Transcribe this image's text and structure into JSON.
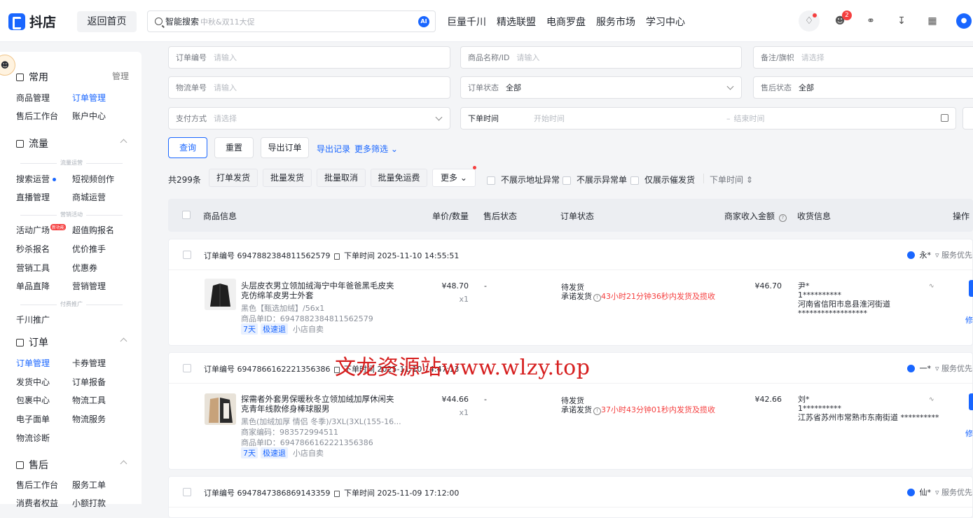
{
  "app": {
    "logo_text": "抖店",
    "home_button": "返回首页"
  },
  "search": {
    "label": "智能搜索",
    "placeholder": "中秋&双11大促",
    "ai_badge": "AI"
  },
  "topnav": [
    "巨量千川",
    "精选联盟",
    "电商罗盘",
    "服务市场",
    "学习中心"
  ],
  "top_icons": {
    "message_badge": "2"
  },
  "sidebar": {
    "common": {
      "title": "常用",
      "manage": "管理",
      "items": [
        "商品管理",
        "订单管理",
        "售后工作台",
        "账户中心"
      ]
    },
    "traffic": {
      "title": "流量",
      "sub1": "流量运营",
      "items1": [
        "搜索运营",
        "短视频创作",
        "直播管理",
        "商城运营"
      ],
      "sub2": "营销活动",
      "items2": [
        "活动广场",
        "超值购报名",
        "秒杀报名",
        "优价推手",
        "营销工具",
        "优惠券",
        "单品直降",
        "营销管理"
      ],
      "hot": "新功能",
      "sub3": "付费推广",
      "items3": [
        "千川推广"
      ]
    },
    "order": {
      "title": "订单",
      "items": [
        "订单管理",
        "卡券管理",
        "发货中心",
        "订单报备",
        "包裹中心",
        "物流工具",
        "电子面单",
        "物流服务",
        "物流诊断"
      ]
    },
    "aftersale": {
      "title": "售后",
      "items": [
        "售后工作台",
        "服务工单",
        "消费者权益",
        "小额打款"
      ]
    }
  },
  "filters": {
    "order_no": {
      "label": "订单编号",
      "placeholder": "请输入"
    },
    "product": {
      "label": "商品名称/ID",
      "placeholder": "请输入"
    },
    "remark": {
      "label": "备注/旗帜",
      "placeholder": "请选择"
    },
    "logistics": {
      "label": "物流单号",
      "placeholder": "请输入"
    },
    "order_status": {
      "label": "订单状态",
      "value": "全部"
    },
    "after_status": {
      "label": "售后状态",
      "value": "全部"
    },
    "payment": {
      "label": "支付方式",
      "placeholder": "请选择"
    },
    "time": {
      "label": "下单时间",
      "start": "开始时间",
      "sep": "–",
      "end": "结束时间"
    }
  },
  "actions": {
    "query": "查询",
    "reset": "重置",
    "export": "导出订单",
    "export_log": "导出记录",
    "more_filter": "更多筛选"
  },
  "bulk": {
    "count": "共299条",
    "buttons": [
      "打单发货",
      "批量发货",
      "批量取消",
      "批量免运费",
      "更多"
    ],
    "checks": [
      "不展示地址异常",
      "不展示异常单",
      "仅展示催发货"
    ],
    "sort": "下单时间"
  },
  "table_headers": [
    "商品信息",
    "单价/数量",
    "售后状态",
    "订单状态",
    "商家收入金额",
    "收货信息",
    "操作"
  ],
  "orders": [
    {
      "order_no_label": "订单编号",
      "order_no": "6947882384811562579",
      "time_label": "下单时间",
      "time": "2025-11-10 14:55:51",
      "buyer": "永*",
      "service": "服务优先",
      "title": "头层皮衣男立领加绒海宁中年爸爸黑毛皮夹克仿绵羊皮男士外套",
      "spec": "黑色【甄选加绒】/56x1",
      "merchant_code": "",
      "product_id": "商品单ID：6947882384811562579",
      "tags": [
        "7天",
        "极速退",
        "小店自卖"
      ],
      "price": "¥48.70",
      "qty": "x1",
      "after": "-",
      "status": "待发货",
      "promise_prefix": "承诺发货",
      "promise_red": "43小时21分钟36秒内发货及揽收",
      "income": "¥46.70",
      "recv_name": "尹*",
      "recv_phone": "1**********",
      "recv_addr": "河南省信阳市息县淮河街道 ******************",
      "op": "修"
    },
    {
      "order_no_label": "订单编号",
      "order_no": "6947866162221356386",
      "time_label": "下单时间",
      "time": "2025-11-10 14:47:13",
      "buyer": "一*",
      "service": "服务优先",
      "title": "探需者外套男保暖秋冬立领加绒加厚休闲夹克青年线款修身棒球服男",
      "spec": "黑色(加绒加厚 情侣 冬季)/3XL(3XL(155-16...",
      "merchant_code": "商家编码：983572994511",
      "product_id": "商品单ID：6947866162221356386",
      "tags": [
        "7天",
        "极速退",
        "小店自卖"
      ],
      "price": "¥44.66",
      "qty": "x1",
      "after": "-",
      "status": "待发货",
      "promise_prefix": "承诺发货",
      "promise_red": "37小时43分钟01秒内发货及揽收",
      "income": "¥42.66",
      "recv_name": "刘*",
      "recv_phone": "1**********",
      "recv_addr": "江苏省苏州市常熟市东南街道 **********",
      "op": "修"
    },
    {
      "order_no_label": "订单编号",
      "order_no": "6947847386869143359",
      "time_label": "下单时间",
      "time": "2025-11-09 17:12:00",
      "buyer": "仙*",
      "service": "服务优先"
    }
  ],
  "watermark": "文龙资源站www.wlzy.top"
}
